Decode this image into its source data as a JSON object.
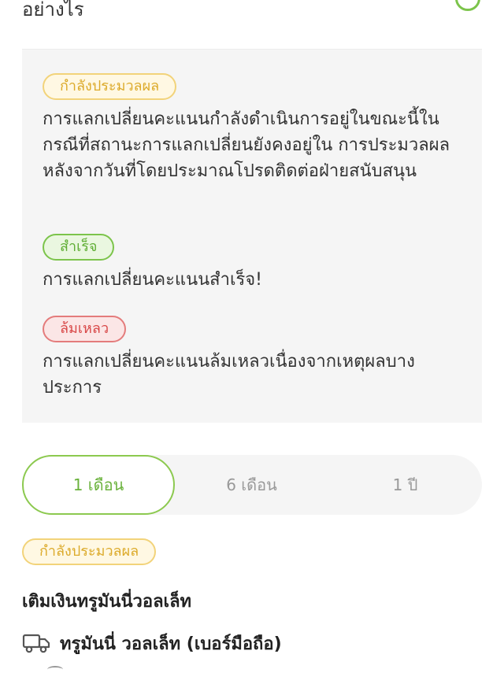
{
  "header": {
    "title": "อย่างไร"
  },
  "statuses": {
    "processing": {
      "label": "กำลังประมวลผล",
      "description": "การแลกเปลี่ยนคะแนนกำลังดำเนินการอยู่ในขณะนี้ในกรณีที่สถานะการแลกเปลี่ยนยังคงอยู่ใน การประมวลผล หลังจากวันที่โดยประมาณโปรดติดต่อฝ่ายสนับสนุน"
    },
    "success": {
      "label": "สำเร็จ",
      "description": "การแลกเปลี่ยนคะแนนสำเร็จ!"
    },
    "failed": {
      "label": "ล้มเหลว",
      "description": "การแลกเปลี่ยนคะแนนล้มเหลวเนื่องจากเหตุผลบางประการ"
    }
  },
  "period_tabs": [
    {
      "label": "1 เดือน",
      "selected": true
    },
    {
      "label": "6 เดือน",
      "selected": false
    },
    {
      "label": "1 ปี",
      "selected": false
    }
  ],
  "transaction": {
    "status_label": "กำลังประมวลผล",
    "title": "เติมเงินทรูมันนี่วอลเล็ท",
    "wallet_label": "ทรูมันนี่ วอลเล็ท (เบอร์มือถือ)",
    "wallet_icon": "truck-icon"
  },
  "colors": {
    "accent_green": "#7cc44b",
    "processing_yellow": "#f2d37a",
    "failed_red": "#e47c7c"
  }
}
